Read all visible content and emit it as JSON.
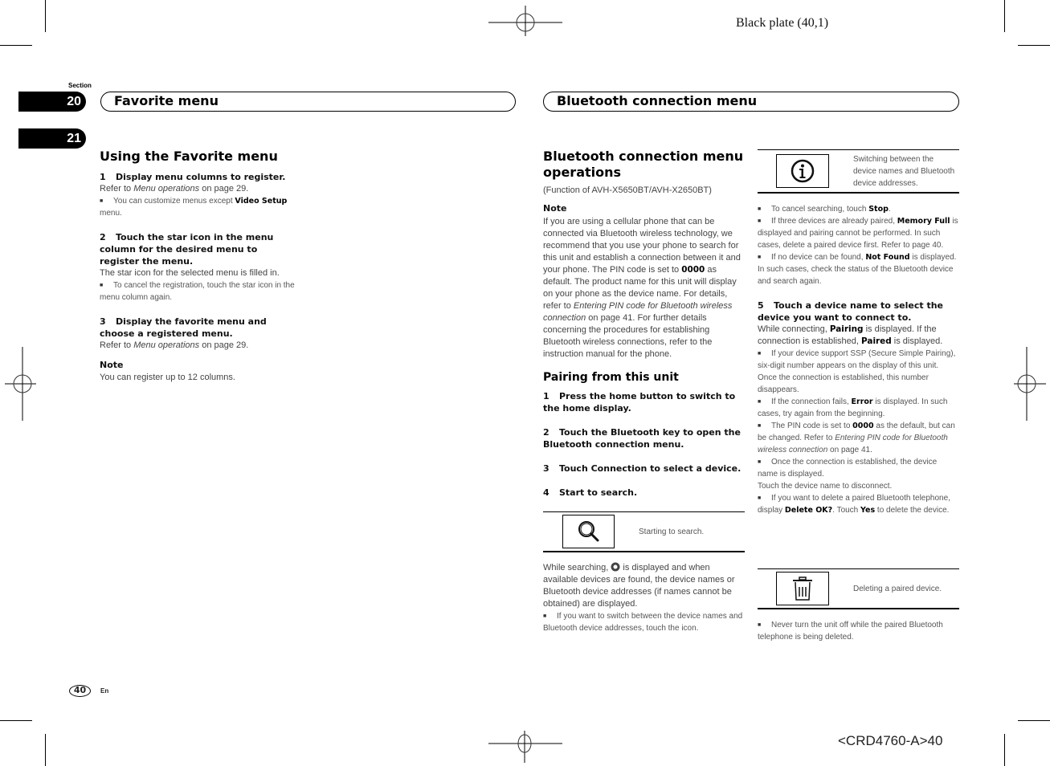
{
  "print_marks": {
    "plate": "Black plate (40,1)",
    "code": "<CRD4760-A>40"
  },
  "section": {
    "label": "Section",
    "tabs": [
      "20",
      "21"
    ]
  },
  "banners": {
    "left": "Favorite menu",
    "right": "Bluetooth connection menu"
  },
  "favorite": {
    "title": "Using the Favorite menu",
    "step1": {
      "num": "1",
      "title": "Display menu columns to register.",
      "ref_pre": "Refer to ",
      "ref_link": "Menu operations",
      "ref_post": " on page 29.",
      "bullet_pre": "You can customize menus except ",
      "bullet_bold": "Video Setup",
      "bullet_post": " menu."
    },
    "step2": {
      "num": "2",
      "title": "Touch the star icon in the menu column for the desired menu to register the menu.",
      "body": "The star icon for the selected menu is filled in.",
      "bullet": "To cancel the registration, touch the star icon in the menu column again."
    },
    "step3": {
      "num": "3",
      "title": "Display the favorite menu and choose a registered menu.",
      "ref_pre": "Refer to ",
      "ref_link": "Menu operations",
      "ref_post": " on page 29."
    },
    "note_label": "Note",
    "note_text": "You can register up to 12 columns."
  },
  "bluetooth": {
    "title": "Bluetooth connection menu operations",
    "function_of": "(Function of AVH-X5650BT/AVH-X2650BT)",
    "note_label": "Note",
    "note": {
      "p1": "If you are using a cellular phone that can be connected via Bluetooth wireless technology, we recommend that you use your phone to search for this unit and establish a connection between it and your phone. The PIN code is set to ",
      "pin": "0000",
      "p2": " as default. The product name for this unit will display on your phone as the device name. For details, refer to ",
      "link": "Entering PIN code for Bluetooth wireless connection",
      "p3": " on page 41. For further details concerning the procedures for establishing Bluetooth wireless connections, refer to the instruction manual for the phone."
    },
    "pairing_title": "Pairing from this unit",
    "steps": [
      {
        "num": "1",
        "text": "Press the home button to switch to the home display."
      },
      {
        "num": "2",
        "text": "Touch the Bluetooth key to open the Bluetooth connection menu."
      },
      {
        "num": "3",
        "text": "Touch Connection to select a device."
      },
      {
        "num": "4",
        "text": "Start to search."
      }
    ],
    "search_icon_row": {
      "icon": "search-icon",
      "text": "Starting to search."
    },
    "while_searching_pre": "While searching, ",
    "while_searching_post": " is displayed and when available devices are found, the device names or Bluetooth device addresses (if names cannot be obtained) are displayed.",
    "switch_bullet": "If you want to switch between the device names and Bluetooth device addresses, touch the icon.",
    "info_icon_row": {
      "icon": "info-icon",
      "text": "Switching between the device names and Bluetooth device addresses."
    },
    "bullets_a": [
      {
        "pre": "To cancel searching, touch ",
        "bold": "Stop",
        "post": "."
      },
      {
        "pre": "If three devices are already paired, ",
        "bold": "Memory Full",
        "post": " is displayed and pairing cannot be performed. In such cases, delete a paired device first. Refer to page 40."
      },
      {
        "pre": "If no device can be found, ",
        "bold": "Not Found",
        "post": " is displayed. In such cases, check the status of the Bluetooth device and search again."
      }
    ],
    "step5": {
      "num": "5",
      "title": "Touch a device name to select the device you want to connect to.",
      "b_pre": "While connecting, ",
      "b_bold1": "Pairing",
      "b_mid": " is displayed. If the connection is established, ",
      "b_bold2": "Paired",
      "b_post": " is displayed."
    },
    "bullets_b": [
      {
        "pre": "If your device support SSP (Secure Simple Pairing), six-digit number appears on the display of this unit. Once the connection is established, this number disappears.",
        "bold": "",
        "post": ""
      },
      {
        "pre": "If the connection fails, ",
        "bold": "Error",
        "post": " is displayed. In such cases, try again from the beginning."
      }
    ],
    "pin_bullet": {
      "pre": "The PIN code is set to ",
      "bold": "0000",
      "mid": " as the default, but can be changed. Refer to ",
      "link": "Entering PIN code for Bluetooth wireless connection",
      "post": " on page 41."
    },
    "once_bullet": "Once the connection is established, the device name is displayed.",
    "disconnect": "Touch the device name to disconnect.",
    "delete_bullet": {
      "pre": "If you want to delete a paired Bluetooth telephone, display ",
      "bold1": "Delete OK?",
      "mid": ". Touch ",
      "bold2": "Yes",
      "post": " to delete the device."
    },
    "trash_icon_row": {
      "icon": "trash-icon",
      "text": "Deleting a paired device."
    },
    "never_bullet": "Never turn the unit off while the paired Bluetooth telephone is being deleted."
  },
  "footer": {
    "page": "40",
    "lang": "En"
  }
}
